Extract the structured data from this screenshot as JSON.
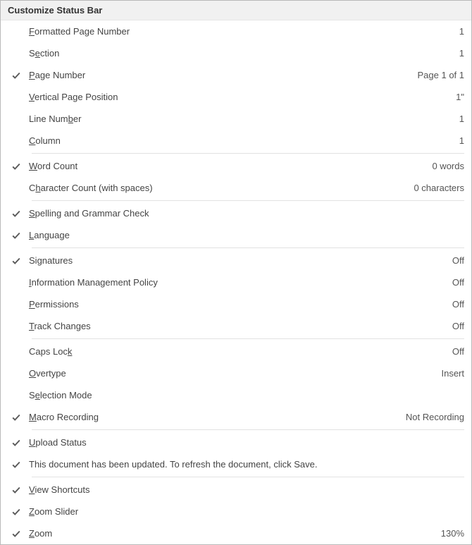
{
  "title": "Customize Status Bar",
  "items": [
    {
      "id": "formatted-page-number",
      "checked": false,
      "label": "Formatted Page Number",
      "mnemonic": "F",
      "value": "1"
    },
    {
      "id": "section",
      "checked": false,
      "label": "Section",
      "mnemonic": "e",
      "value": "1"
    },
    {
      "id": "page-number",
      "checked": true,
      "label": "Page Number",
      "mnemonic": "P",
      "value": "Page 1 of 1"
    },
    {
      "id": "vertical-page-position",
      "checked": false,
      "label": "Vertical Page Position",
      "mnemonic": "V",
      "value": "1\""
    },
    {
      "id": "line-number",
      "checked": false,
      "label": "Line Number",
      "mnemonic": "b",
      "value": "1"
    },
    {
      "id": "column",
      "checked": false,
      "label": "Column",
      "mnemonic": "C",
      "value": "1"
    },
    {
      "separator": true
    },
    {
      "id": "word-count",
      "checked": true,
      "label": "Word Count",
      "mnemonic": "W",
      "value": "0 words"
    },
    {
      "id": "character-count",
      "checked": false,
      "label": "Character Count (with spaces)",
      "mnemonic": "h",
      "value": "0 characters"
    },
    {
      "separator": true
    },
    {
      "id": "spelling-grammar",
      "checked": true,
      "label": "Spelling and Grammar Check",
      "mnemonic": "S",
      "value": ""
    },
    {
      "id": "language",
      "checked": true,
      "label": "Language",
      "mnemonic": "L",
      "value": ""
    },
    {
      "separator": true
    },
    {
      "id": "signatures",
      "checked": true,
      "label": "Signatures",
      "mnemonic": "g",
      "value": "Off"
    },
    {
      "id": "info-mgmt-policy",
      "checked": false,
      "label": "Information Management Policy",
      "mnemonic": "I",
      "value": "Off"
    },
    {
      "id": "permissions",
      "checked": false,
      "label": "Permissions",
      "mnemonic": "P",
      "value": "Off"
    },
    {
      "id": "track-changes",
      "checked": false,
      "label": "Track Changes",
      "mnemonic": "T",
      "value": "Off"
    },
    {
      "separator": true
    },
    {
      "id": "caps-lock",
      "checked": false,
      "label": "Caps Lock",
      "mnemonic": "k",
      "value": "Off"
    },
    {
      "id": "overtype",
      "checked": false,
      "label": "Overtype",
      "mnemonic": "O",
      "value": "Insert"
    },
    {
      "id": "selection-mode",
      "checked": false,
      "label": "Selection Mode",
      "mnemonic": "e",
      "value": ""
    },
    {
      "id": "macro-recording",
      "checked": true,
      "label": "Macro Recording",
      "mnemonic": "M",
      "value": "Not Recording"
    },
    {
      "separator": true
    },
    {
      "id": "upload-status",
      "checked": true,
      "label": "Upload Status",
      "mnemonic": "U",
      "value": ""
    },
    {
      "id": "document-updates",
      "checked": true,
      "label": "This document has been updated. To refresh the document, click Save.",
      "mnemonic": "",
      "value": ""
    },
    {
      "separator": true
    },
    {
      "id": "view-shortcuts",
      "checked": true,
      "label": "View Shortcuts",
      "mnemonic": "V",
      "value": ""
    },
    {
      "id": "zoom-slider",
      "checked": true,
      "label": "Zoom Slider",
      "mnemonic": "Z",
      "value": ""
    },
    {
      "id": "zoom",
      "checked": true,
      "label": "Zoom",
      "mnemonic": "Z",
      "value": "130%"
    }
  ]
}
